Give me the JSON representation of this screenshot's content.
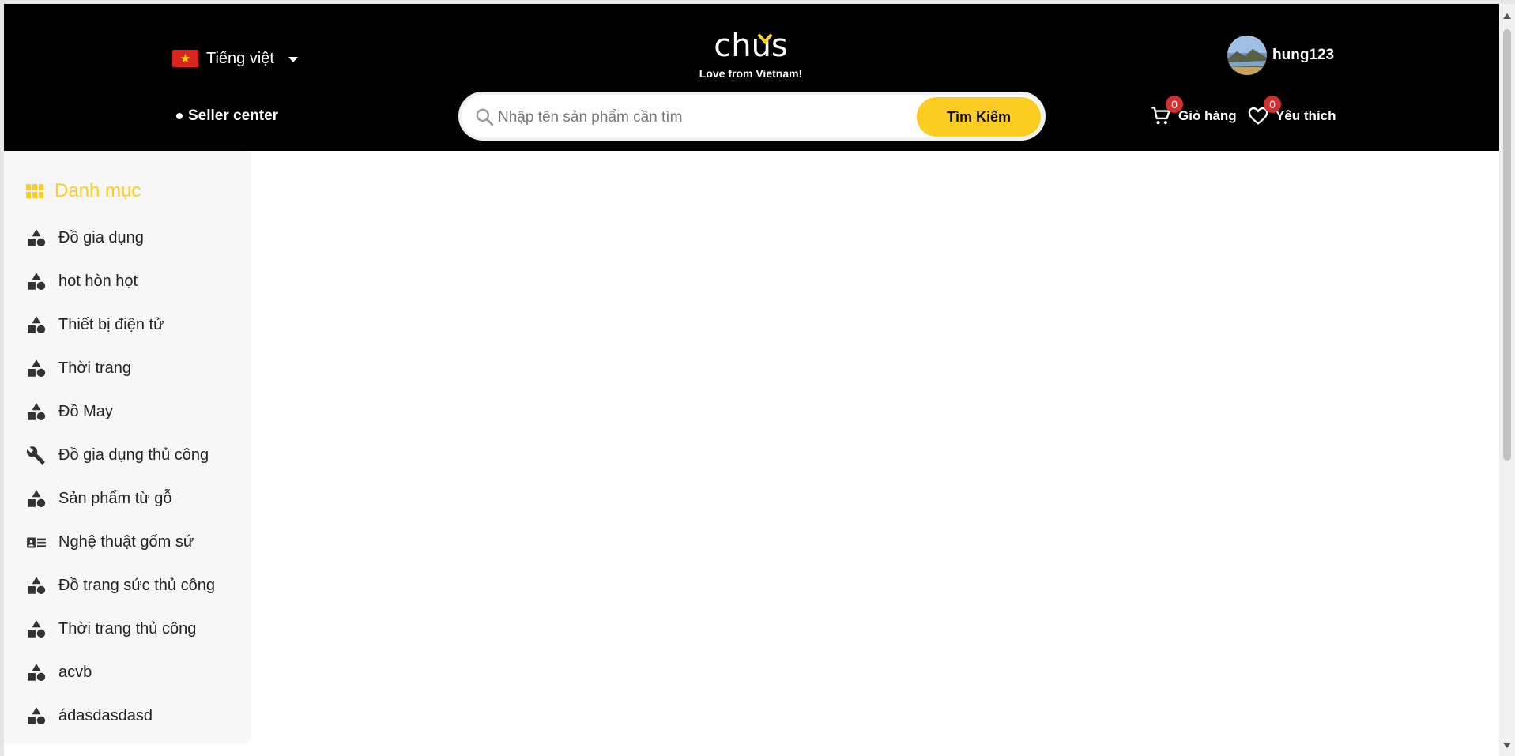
{
  "header": {
    "language_label": "Tiếng việt",
    "seller_center_label": "Seller center",
    "logo": {
      "text": "chus",
      "tagline": "Love from Vietnam!"
    },
    "search": {
      "placeholder": "Nhập tên sản phẩm cần tìm",
      "value": "",
      "button_label": "Tìm Kiếm"
    },
    "user": {
      "username": "hung123"
    },
    "cart": {
      "label": "Giỏ hàng",
      "count": "0"
    },
    "wishlist": {
      "label": "Yêu thích",
      "count": "0"
    }
  },
  "sidebar": {
    "title": "Danh mục",
    "items": [
      {
        "label": "Đồ gia dụng",
        "icon": "shapes-icon"
      },
      {
        "label": "hot hòn họt",
        "icon": "shapes-icon"
      },
      {
        "label": "Thiết bị điện tử",
        "icon": "shapes-icon"
      },
      {
        "label": "Thời trang",
        "icon": "shapes-icon"
      },
      {
        "label": "Đồ May",
        "icon": "shapes-icon"
      },
      {
        "label": "Đồ gia dụng thủ công",
        "icon": "wrench-icon"
      },
      {
        "label": "Sản phẩm từ gỗ",
        "icon": "shapes-icon"
      },
      {
        "label": "Nghệ thuật gốm sứ",
        "icon": "card-icon"
      },
      {
        "label": "Đồ trang sức thủ công",
        "icon": "shapes-icon"
      },
      {
        "label": "Thời trang thủ công",
        "icon": "shapes-icon"
      },
      {
        "label": "acvb",
        "icon": "shapes-icon"
      },
      {
        "label": "ádasdasdasd",
        "icon": "shapes-icon"
      }
    ]
  },
  "colors": {
    "accent": "#fccc22",
    "header_bg": "#000000",
    "badge": "#d32f2f"
  }
}
